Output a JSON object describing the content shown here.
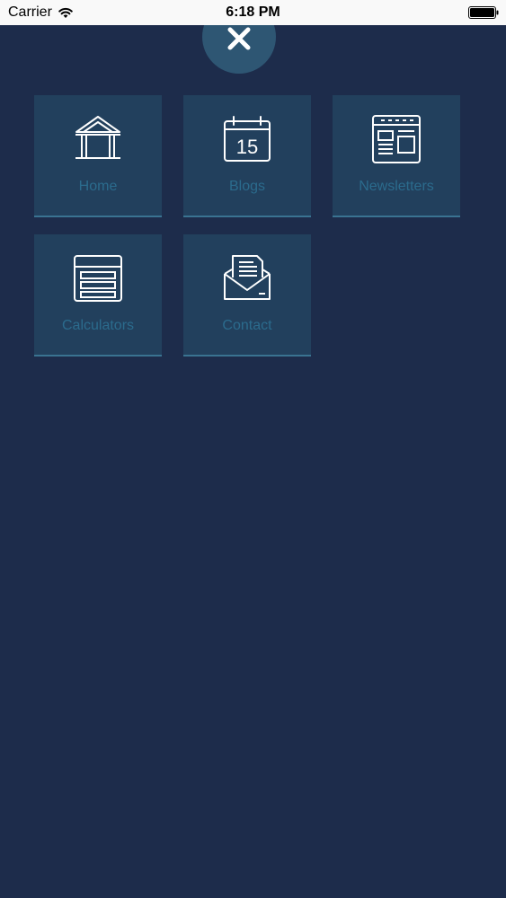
{
  "status_bar": {
    "carrier": "Carrier",
    "time": "6:18 PM"
  },
  "close_button": {
    "icon": "close-icon"
  },
  "menu": {
    "items": [
      {
        "label": "Home",
        "icon": "home-building-icon"
      },
      {
        "label": "Blogs",
        "icon": "calendar-icon",
        "icon_text": "15"
      },
      {
        "label": "Newsletters",
        "icon": "newsletter-icon"
      },
      {
        "label": "Calculators",
        "icon": "calculator-icon"
      },
      {
        "label": "Contact",
        "icon": "envelope-letter-icon"
      }
    ]
  },
  "colors": {
    "background": "#1d2c4b",
    "tile": "#22405d",
    "tile_border": "#3a7391",
    "tile_label": "#2b6b8d",
    "icon_stroke": "#ffffff",
    "close_circle": "#2e5673"
  }
}
